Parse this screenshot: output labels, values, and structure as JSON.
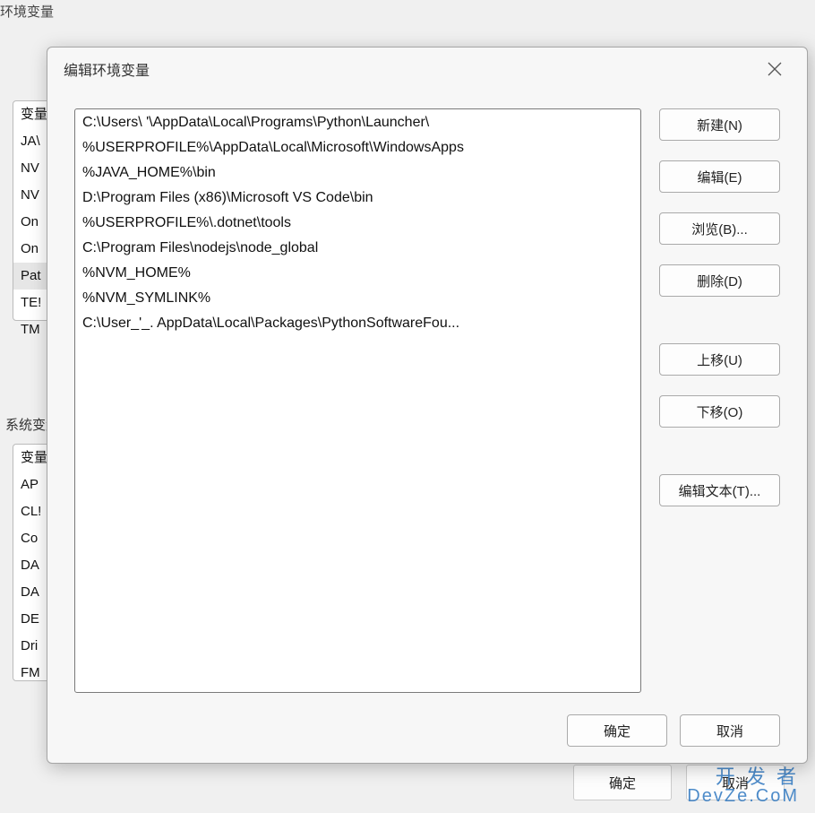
{
  "bg_window": {
    "title": "环境变量",
    "user_vars_label": "系统变量",
    "user_table_header": "变量",
    "user_rows": [
      "JA\\",
      "NV",
      "NV",
      "On",
      "On",
      "Pat",
      "TE!",
      "TM"
    ],
    "user_selected_index": 5,
    "sys_rows": [
      "变量",
      "AP",
      "CL!",
      "Co",
      "DA",
      "DA",
      "DE",
      "Dri",
      "FM"
    ],
    "ok_button": "确定",
    "cancel_button": "取消"
  },
  "modal": {
    "title": "编辑环境变量",
    "close_icon": "close-icon",
    "paths": [
      "C:\\Users\\            '\\AppData\\Local\\Programs\\Python\\Launcher\\",
      "%USERPROFILE%\\AppData\\Local\\Microsoft\\WindowsApps",
      "%JAVA_HOME%\\bin",
      "D:\\Program Files (x86)\\Microsoft VS Code\\bin",
      "%USERPROFILE%\\.dotnet\\tools",
      "C:\\Program Files\\nodejs\\node_global",
      "%NVM_HOME%",
      "%NVM_SYMLINK%",
      "C:\\User_'_.                AppData\\Local\\Packages\\PythonSoftwareFou..."
    ],
    "buttons": {
      "new": "新建(N)",
      "edit": "编辑(E)",
      "browse": "浏览(B)...",
      "delete": "删除(D)",
      "move_up": "上移(U)",
      "move_down": "下移(O)",
      "edit_text": "编辑文本(T)...",
      "ok": "确定",
      "cancel": "取消"
    }
  },
  "watermark": {
    "line1": "开 发 者",
    "line2": "DevZe.CoM"
  }
}
